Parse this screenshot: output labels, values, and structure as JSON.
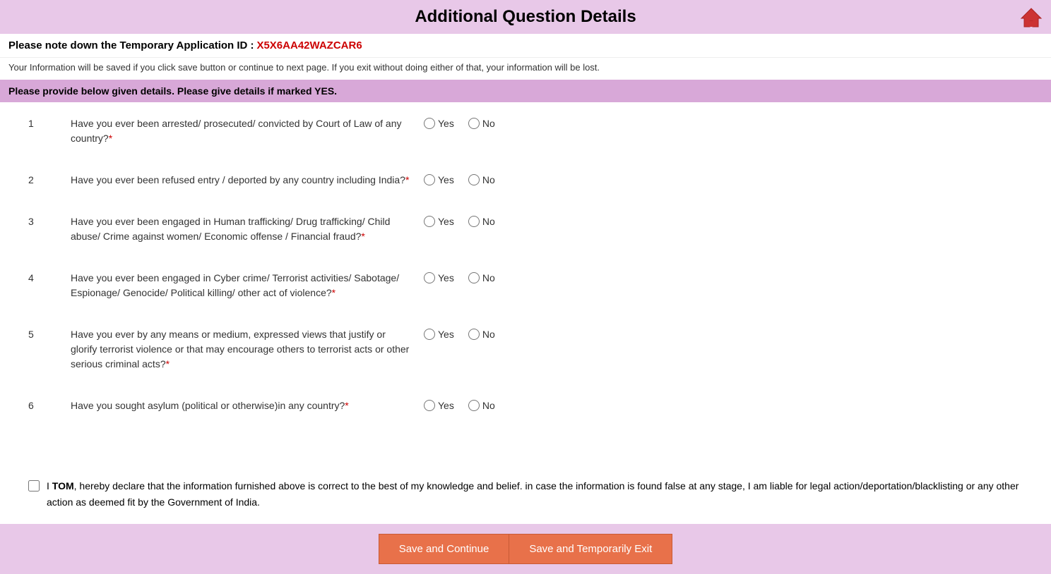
{
  "header": {
    "title": "Additional Question Details",
    "home_icon": "🏠"
  },
  "temp_id": {
    "label": "Please note down the Temporary Application ID :",
    "value": "X5X6AA42WAZCAR6"
  },
  "info_text": "Your Information will be saved if you click save button or continue to next page. If you exit without doing either of that, your information will be lost.",
  "section_header": "Please provide below given details. Please give details if marked YES.",
  "questions": [
    {
      "number": "1",
      "text": "Have you ever been arrested/ prosecuted/ convicted by Court of Law of any country?",
      "required": true
    },
    {
      "number": "2",
      "text": "Have you ever been refused entry / deported by any country including India?",
      "required": true
    },
    {
      "number": "3",
      "text": "Have you ever been engaged in Human trafficking/ Drug trafficking/ Child abuse/ Crime against women/ Economic offense / Financial fraud?",
      "required": true
    },
    {
      "number": "4",
      "text": "Have you ever been engaged in Cyber crime/ Terrorist activities/ Sabotage/ Espionage/ Genocide/ Political killing/ other act of violence?",
      "required": true
    },
    {
      "number": "5",
      "text": "Have you ever by any means or medium, expressed views that justify or glorify terrorist violence or that may encourage others to terrorist acts or other serious criminal acts?",
      "required": true
    },
    {
      "number": "6",
      "text": "Have you sought asylum (political or otherwise)in any country?",
      "required": true
    }
  ],
  "radio_labels": {
    "yes": "Yes",
    "no": "No"
  },
  "declaration": {
    "name": "TOM",
    "text_before_name": "I ",
    "text_after_name": ", hereby declare that the information furnished above is correct to the best of my knowledge and belief. in case the information is found false at any stage, I am liable for legal action/deportation/blacklisting or any other action as deemed fit by the Government of India."
  },
  "buttons": {
    "save_continue": "Save and Continue",
    "save_exit": "Save and Temporarily Exit"
  }
}
